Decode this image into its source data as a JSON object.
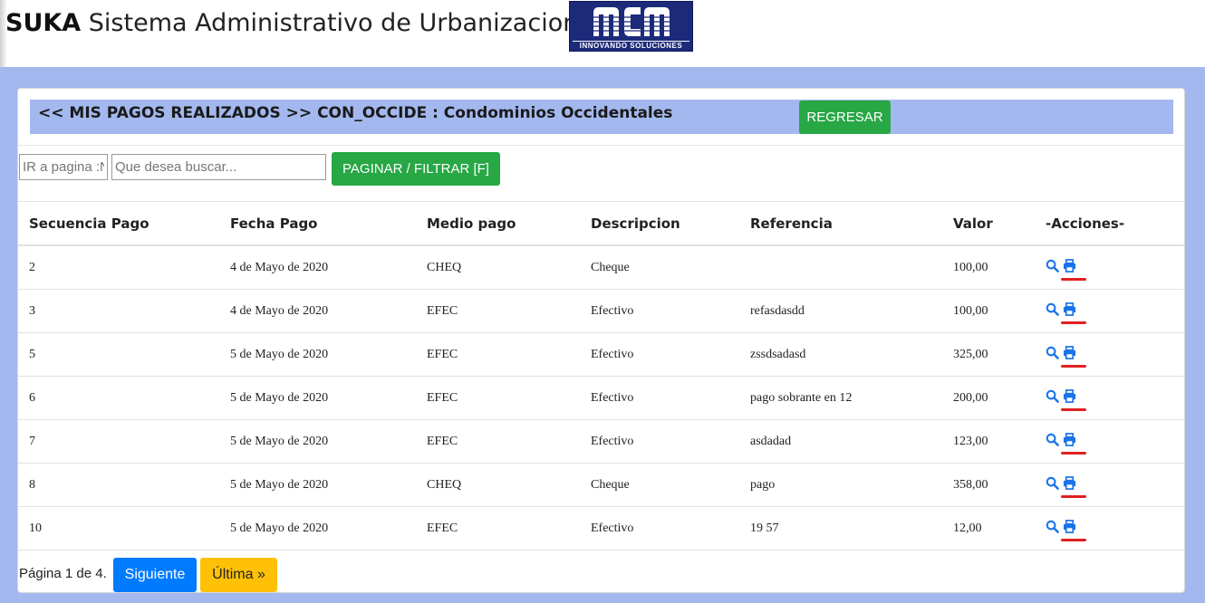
{
  "app": {
    "brand": "SUKA",
    "title": " Sistema Administrativo de Urbanizaciones",
    "logo_text": "INNOVANDO   SOLUCIONES"
  },
  "header": {
    "title": "<< MIS PAGOS REALIZADOS >> CON_OCCIDE : Condominios Occidentales",
    "back_button": "REGRESAR"
  },
  "filters": {
    "page_placeholder": "IR a pagina :N",
    "search_placeholder": "Que desea buscar...",
    "filter_button": "PAGINAR / FILTRAR [F]"
  },
  "table": {
    "columns": [
      "Secuencia Pago",
      "Fecha Pago",
      "Medio pago",
      "Descripcion",
      "Referencia",
      "Valor",
      "-Acciones-"
    ],
    "rows": [
      {
        "seq": "2",
        "date": "4 de Mayo de 2020",
        "method": "CHEQ",
        "desc": "Cheque",
        "ref": "",
        "value": "100,00"
      },
      {
        "seq": "3",
        "date": "4 de Mayo de 2020",
        "method": "EFEC",
        "desc": "Efectivo",
        "ref": "refasdasdd",
        "value": "100,00"
      },
      {
        "seq": "5",
        "date": "5 de Mayo de 2020",
        "method": "EFEC",
        "desc": "Efectivo",
        "ref": "zssdsadasd",
        "value": "325,00"
      },
      {
        "seq": "6",
        "date": "5 de Mayo de 2020",
        "method": "EFEC",
        "desc": "Efectivo",
        "ref": "pago sobrante en 12",
        "value": "200,00"
      },
      {
        "seq": "7",
        "date": "5 de Mayo de 2020",
        "method": "EFEC",
        "desc": "Efectivo",
        "ref": "asdadad",
        "value": "123,00"
      },
      {
        "seq": "8",
        "date": "5 de Mayo de 2020",
        "method": "CHEQ",
        "desc": "Cheque",
        "ref": "pago",
        "value": "358,00"
      },
      {
        "seq": "10",
        "date": "5 de Mayo de 2020",
        "method": "EFEC",
        "desc": "Efectivo",
        "ref": "19 57",
        "value": "12,00"
      }
    ]
  },
  "pager": {
    "text": "Página 1 de 4.",
    "next": "Siguiente",
    "last": "Última »"
  },
  "colors": {
    "accent_band": "#a3b8ee",
    "success": "#28a745",
    "primary": "#007bff",
    "warning": "#ffc107",
    "icon": "#1a73e8",
    "mark": "#e02020"
  },
  "icons": {
    "view": "search-icon",
    "print": "print-icon"
  }
}
